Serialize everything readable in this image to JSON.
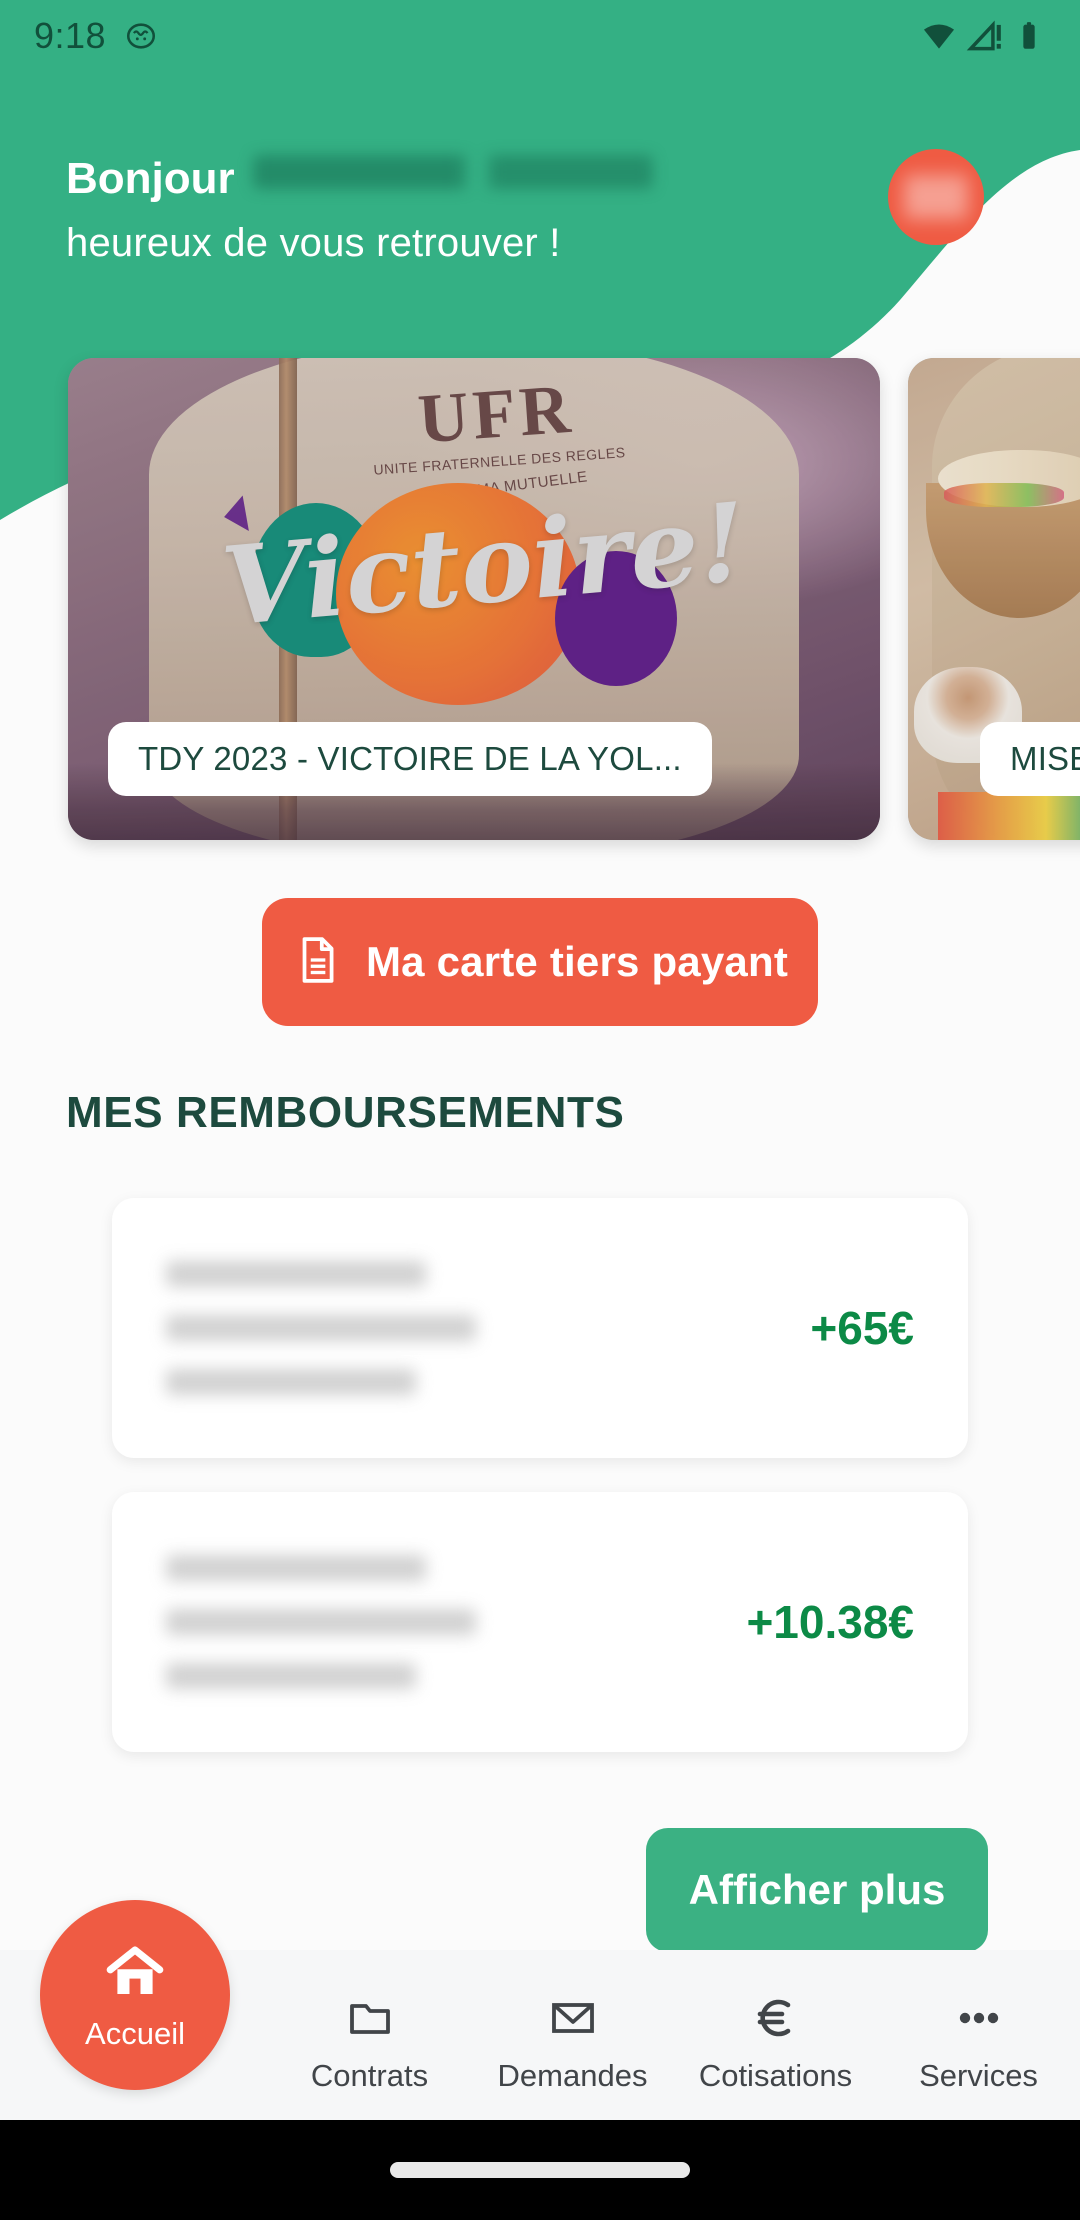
{
  "status_bar": {
    "time": "9:18",
    "icons": [
      "notification-icon",
      "wifi-icon",
      "cellular-signal-icon",
      "battery-icon"
    ]
  },
  "header": {
    "greeting_hello": "Bonjour",
    "greeting_name": "",
    "greeting_line2": "heureux de vous retrouver !",
    "avatar_initials": "",
    "background_color": "#34b084"
  },
  "carousel": {
    "cards": [
      {
        "label": "TDY 2023 - VICTOIRE DE LA YOL...",
        "image_alt": "Victoire! UFR banner photo",
        "image_text_overlay": "Victoire!",
        "image_banner_text": "UFR",
        "image_banner_sub1": "UNITE FRATERNELLE DES REGLES",
        "image_banner_sub2": "MA VIE, MA MUTUELLE"
      },
      {
        "label": "MISE",
        "image_alt": "Bowl of food, coffee cup and tablet photo"
      }
    ]
  },
  "cta": {
    "label": "Ma carte tiers payant",
    "icon": "document-icon",
    "color": "#ef5b43"
  },
  "refunds": {
    "section_title": "MES REMBOURSEMENTS",
    "items": [
      {
        "title": "",
        "date": "",
        "detail": "",
        "amount": "+65€"
      },
      {
        "title": "",
        "date": "",
        "detail": "",
        "amount": "+10.38€"
      }
    ],
    "amount_color": "#0c8a46",
    "show_more_label": "Afficher plus",
    "show_more_color": "#3bb183"
  },
  "bottom_nav": {
    "active": "Accueil",
    "items": [
      {
        "label": "Accueil",
        "icon": "home-icon"
      },
      {
        "label": "Contrats",
        "icon": "folder-icon"
      },
      {
        "label": "Demandes",
        "icon": "envelope-icon"
      },
      {
        "label": "Cotisations",
        "icon": "euro-icon"
      },
      {
        "label": "Services",
        "icon": "ellipsis-icon"
      }
    ]
  }
}
